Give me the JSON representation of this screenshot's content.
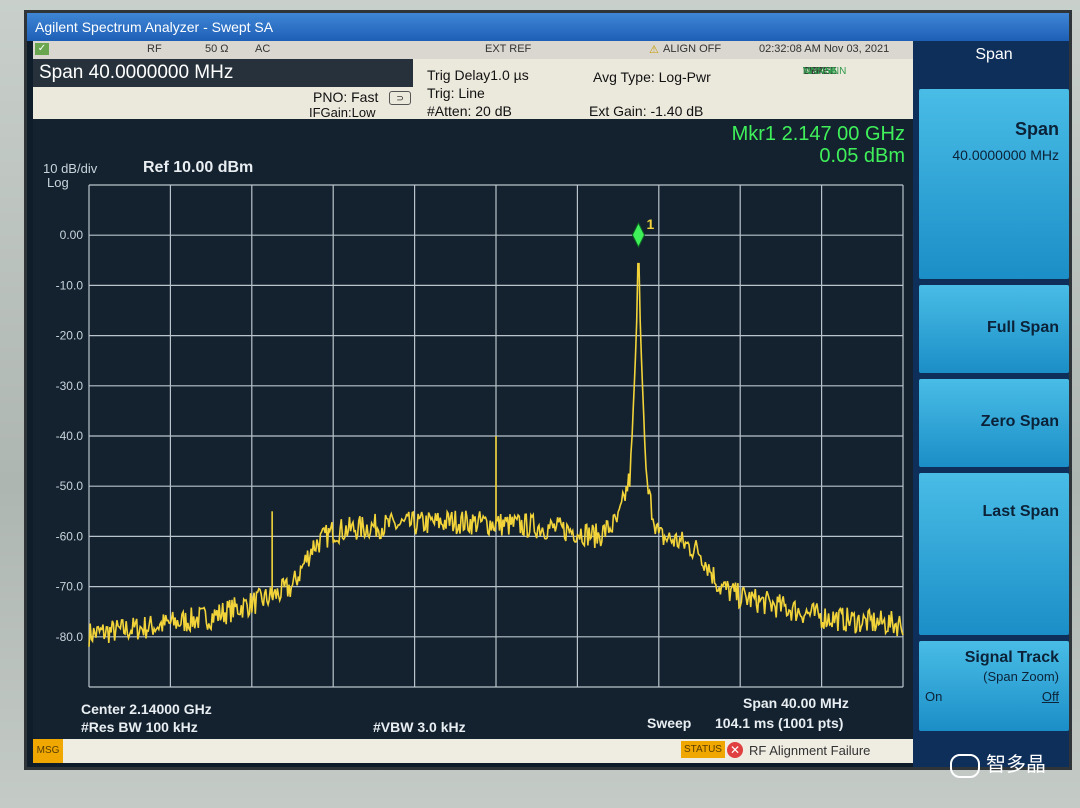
{
  "window": {
    "title": "Agilent Spectrum Analyzer - Swept SA"
  },
  "status_bar": {
    "rf": "RF",
    "impedance": "50 Ω",
    "coupling": "AC",
    "ext_ref": "EXT REF",
    "align": "ALIGN OFF",
    "datetime": "02:32:08 AM Nov 03, 2021"
  },
  "info": {
    "span": "Span 40.0000000 MHz",
    "pno": "PNO: Fast",
    "ifgain": "IFGain:Low",
    "trig_delay": "Trig Delay1.0 µs",
    "trig": "Trig: Line",
    "atten": "#Atten: 20 dB",
    "avg_type": "Avg Type: Log-Pwr",
    "ext_gain": "Ext Gain: -1.40 dB",
    "trace_label": "TRACE",
    "type_label": "TYPE",
    "det_label": "DET",
    "trace_nums": "123456",
    "type_vals": "W",
    "det_vals": "NNNNNN"
  },
  "plot": {
    "scale": "10 dB/div",
    "log": "Log",
    "ref": "Ref 10.00 dBm",
    "marker_freq": "Mkr1 2.147 00 GHz",
    "marker_amp": "0.05 dBm",
    "marker_label": "1",
    "center": "Center 2.14000 GHz",
    "res_bw": "#Res BW 100 kHz",
    "vbw": "#VBW 3.0 kHz",
    "span_bottom": "Span 40.00 MHz",
    "sweep": "Sweep",
    "sweep_val": "104.1 ms (1001 pts)"
  },
  "softkeys": {
    "header": "Span",
    "span_title": "Span",
    "span_value": "40.0000000 MHz",
    "full_span": "Full Span",
    "zero_span": "Zero Span",
    "last_span": "Last Span",
    "signal_track": "Signal Track",
    "span_zoom": "(Span Zoom)",
    "on": "On",
    "off": "Off"
  },
  "message": {
    "msg": "MSG",
    "status": "STATUS",
    "text": "RF Alignment Failure"
  },
  "watermark": "智多晶",
  "chart_data": {
    "type": "line",
    "ylabel": "dBm",
    "y_ticks": [
      "0.00",
      "-10.0",
      "-20.0",
      "-30.0",
      "-40.0",
      "-50.0",
      "-60.0",
      "-70.0",
      "-80.0"
    ],
    "ylim": [
      -90,
      10
    ],
    "x_center_ghz": 2.14,
    "x_span_mhz": 40,
    "grid": true,
    "color": "#f2d43a",
    "series": [
      {
        "x_offset_mhz": [
          -20,
          -17,
          -14,
          -11,
          -10,
          -9,
          -8,
          -6,
          -4,
          -2,
          0,
          2,
          4,
          5,
          6,
          6.6,
          6.9,
          7.0,
          7.1,
          7.4,
          8,
          9,
          10,
          11,
          12,
          14,
          16,
          18,
          20
        ],
        "dbm": [
          -79.5,
          -78,
          -76,
          -72,
          -70,
          -62,
          -59,
          -58,
          -57.5,
          -57,
          -57.5,
          -58,
          -59,
          -60,
          -57,
          -48,
          -20,
          0.05,
          -20,
          -50,
          -60,
          -61,
          -63,
          -70,
          -72,
          -74,
          -76,
          -77,
          -77.5
        ]
      }
    ],
    "spurs": [
      {
        "x_offset_mhz": 0,
        "dbm": -40
      },
      {
        "x_offset_mhz": -11,
        "dbm": -55
      }
    ]
  }
}
